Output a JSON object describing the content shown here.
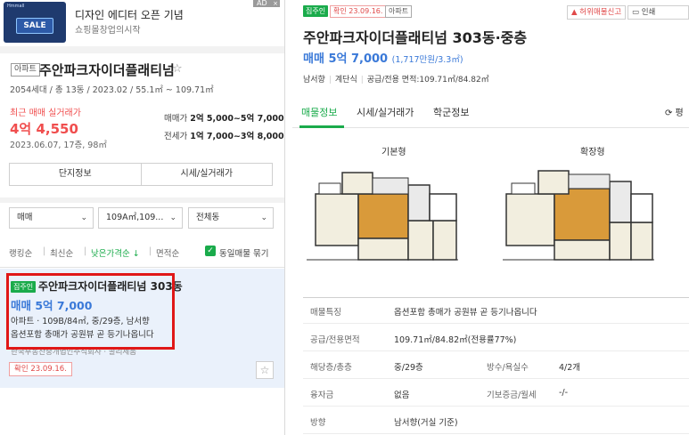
{
  "ad": {
    "brand_text": "Hmmall",
    "thumb_text": "SALE",
    "title": "디자인 에디터 오픈 기념",
    "subtitle": "쇼핑몰창업의시작",
    "badge": "AD",
    "close": "×"
  },
  "complex": {
    "type_tag": "아파트",
    "name": "주안파크자이더플래티넘",
    "star": "☆",
    "meta": "2054세대 / 총 13동 / 2023.02 / 55.1㎡ ~ 109.71㎡",
    "recent_label": "최근 매매 실거래가",
    "recent_price": "4억 4,550",
    "recent_date": "2023.06.07, 17층, 98㎡",
    "sale_label": "매매가",
    "sale_range": "2억 5,000~5억 7,000",
    "jeonse_label": "전세가",
    "jeonse_range": "1억 7,000~3억 8,000",
    "btn_info": "단지정보",
    "btn_price": "시세/실거래가"
  },
  "filters": {
    "trade_type": "매매",
    "area": "109A㎡,109...",
    "dong": "전체동",
    "chevron": "⌄"
  },
  "sort": {
    "items": [
      "랭킹순",
      "최신순",
      "낮은가격순",
      "면적순"
    ],
    "active_arrow": "↓",
    "same_listing_label": "동일매물 묶기",
    "check": "✓"
  },
  "listing": {
    "tag": "집주인",
    "title": "주안파크자이더플래티넘 303동",
    "price": "매매 5억 7,000",
    "spec": "아파트 · 109B/84㎡, 중/29층, 남서향",
    "desc": "옵션포함 총매가 공원뷰 곧 등기나옵니다",
    "agent": "한국부동산중개법인주식회사 · 콜리세움",
    "confirm": "확인 23.09.16.",
    "star": "☆"
  },
  "detail": {
    "owner_tag": "집주인",
    "confirm": "확인 23.09.16.",
    "type_tag": "아파트",
    "report_btn": "허위매물신고",
    "print_btn": "인쇄",
    "title": "주안파크자이더플래티넘 303동·중층",
    "price": "매매 5억 7,000",
    "price_per": "(1,717만원/3.3㎡)",
    "spec_direction": "남서향",
    "spec_stairs": "계단식",
    "spec_area": "공급/전용 면적:109.71㎡/84.82㎡",
    "tabs": [
      "매물정보",
      "시세/실거래가",
      "학군정보"
    ],
    "refresh_label": "⟳ 평",
    "floorplan_basic": "기본형",
    "floorplan_extended": "확장형",
    "table": [
      {
        "k": "매물특징",
        "v": "옵션포함 총매가 공원뷰 곧 등기나옵니다"
      },
      {
        "k": "공급/전용면적",
        "v": "109.71㎡/84.82㎡(전용률77%)"
      },
      {
        "k": "해당층/총층",
        "v": "중/29층",
        "k2": "방수/욕실수",
        "v2": "4/2개"
      },
      {
        "k": "융자금",
        "v": "없음",
        "k2": "기보증금/월세",
        "v2": "-/-"
      },
      {
        "k": "방향",
        "v": "남서향(거실 기준)"
      }
    ]
  },
  "colors": {
    "accent_green": "#1aab4b",
    "price_blue": "#3a79d8",
    "recent_red": "#f04e4e",
    "highlight_red": "#e01717"
  }
}
